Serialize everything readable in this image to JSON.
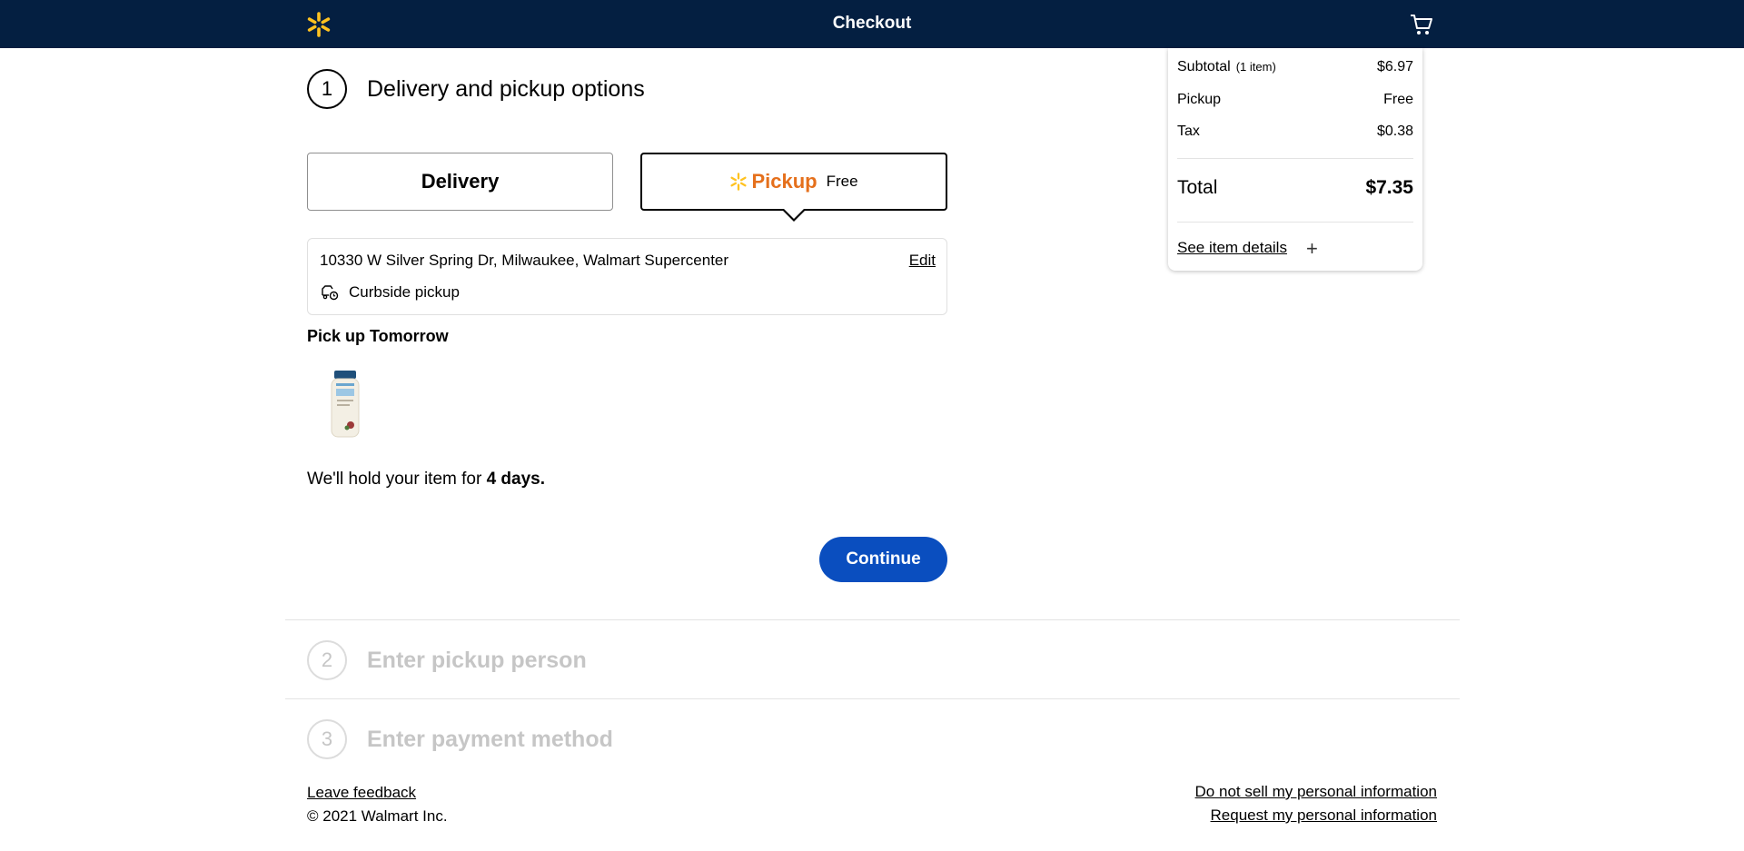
{
  "header": {
    "title": "Checkout",
    "logo_icon": "walmart-spark",
    "cart_icon": "cart"
  },
  "step1": {
    "number": "1",
    "title": "Delivery and pickup options"
  },
  "options": {
    "delivery_label": "Delivery",
    "pickup_label": "Pickup",
    "pickup_price": "Free"
  },
  "store": {
    "address": "10330 W Silver Spring Dr, Milwaukee, Walmart Supercenter",
    "edit_label": "Edit",
    "method": "Curbside pickup"
  },
  "pickup_when": "Pick up Tomorrow",
  "hold": {
    "prefix": "We'll hold your item for ",
    "days": "4 days."
  },
  "continue_label": "Continue",
  "step2": {
    "number": "2",
    "title": "Enter pickup person"
  },
  "step3": {
    "number": "3",
    "title": "Enter payment method"
  },
  "footer": {
    "feedback": "Leave feedback",
    "copyright": "© 2021 Walmart Inc.",
    "do_not_sell": "Do not sell my personal information",
    "request_info": "Request my personal information"
  },
  "summary": {
    "subtotal_label": "Subtotal",
    "subtotal_count": "(1 item)",
    "subtotal_value": "$6.97",
    "pickup_label": "Pickup",
    "pickup_value": "Free",
    "tax_label": "Tax",
    "tax_value": "$0.38",
    "total_label": "Total",
    "total_value": "$7.35",
    "details_label": "See item details"
  },
  "colors": {
    "header_bg": "#041f41",
    "spark": "#ffc220",
    "pickup_orange": "#e5701c",
    "primary_button": "#0a4ebf"
  }
}
